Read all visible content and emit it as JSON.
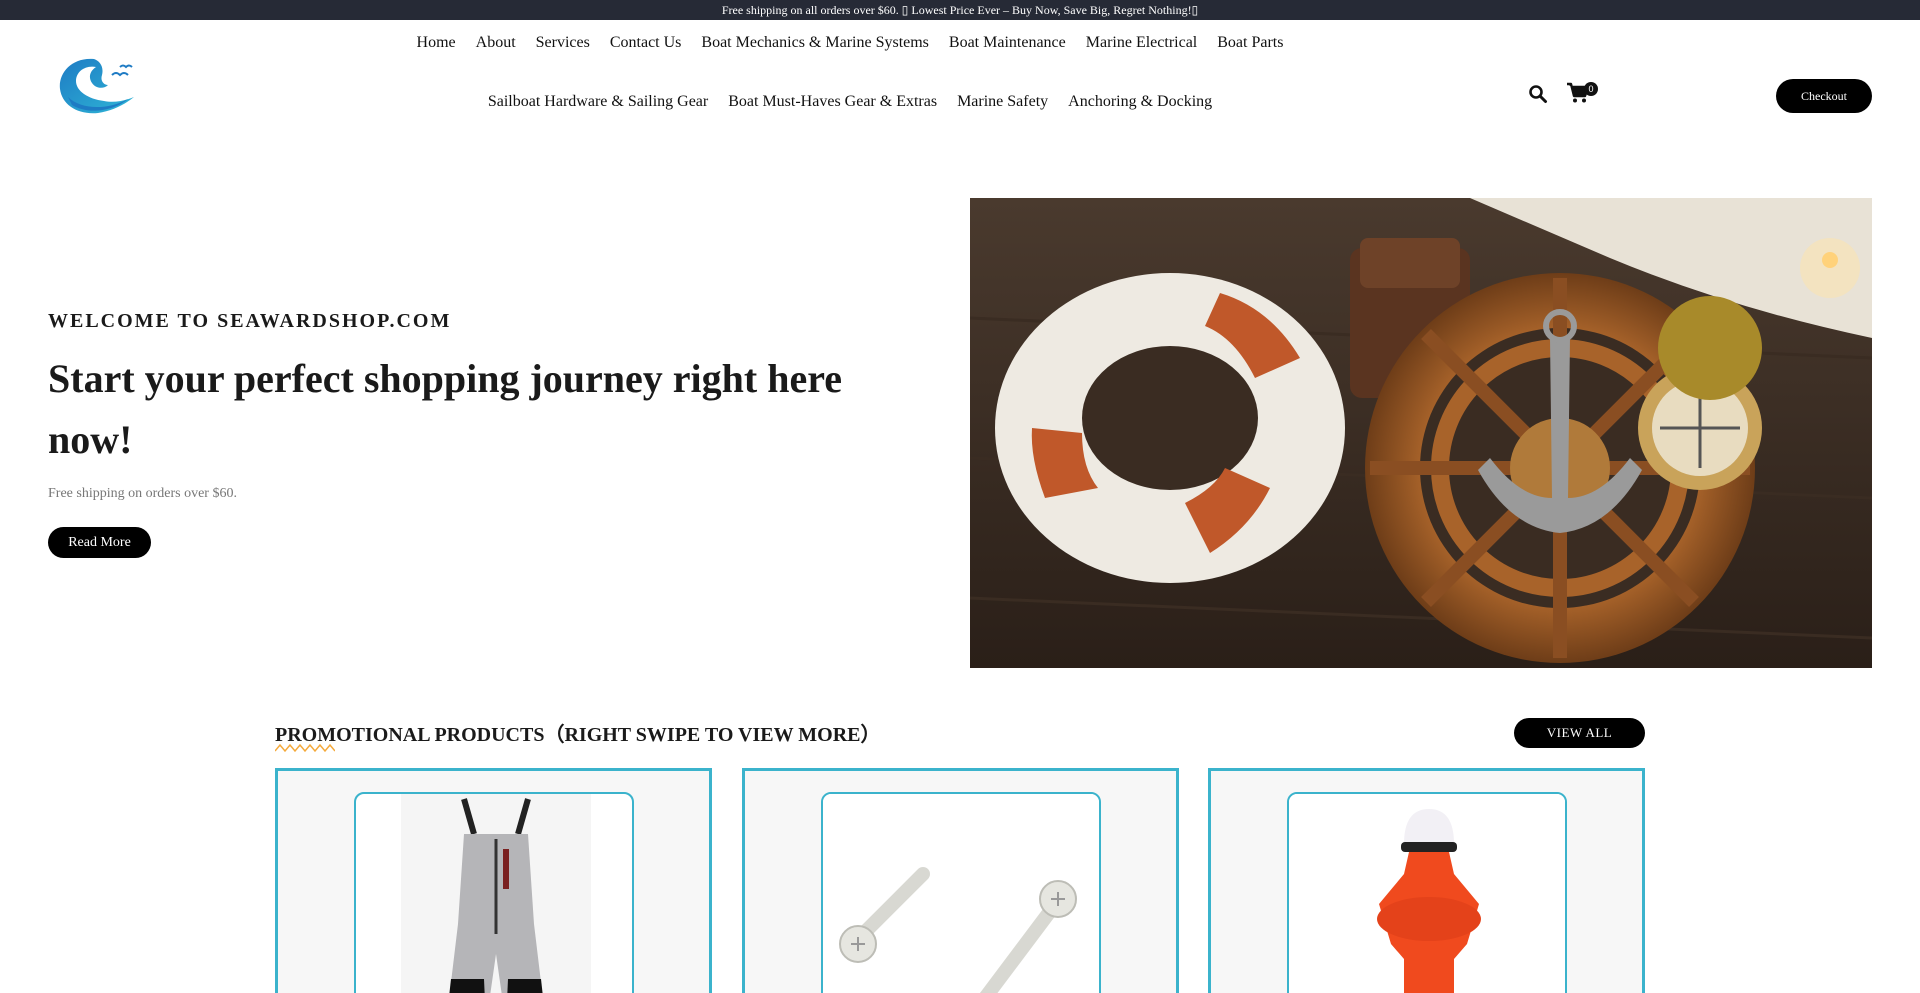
{
  "announcement": "Free shipping on all orders over $60. ▯ Lowest Price Ever – Buy Now, Save Big, Regret Nothing!▯",
  "nav": {
    "row1": [
      "Home",
      "About",
      "Services",
      "Contact Us",
      "Boat Mechanics & Marine Systems",
      "Boat Maintenance",
      "Marine Electrical",
      "Boat Parts"
    ],
    "row2": [
      "Sailboat Hardware & Sailing Gear",
      "Boat Must-Haves Gear & Extras",
      "Marine Safety",
      "Anchoring & Docking"
    ]
  },
  "cart": {
    "count": "0"
  },
  "checkout_label": "Checkout",
  "hero": {
    "kicker": "WELCOME TO SEAWARDSHOP.COM",
    "title": "Start your perfect shopping journey right here now!",
    "subtitle": "Free shipping on orders over $60.",
    "button": "Read More"
  },
  "promo": {
    "title": "PROMOTIONAL PRODUCTS（RIGHT SWIPE TO VIEW MORE）",
    "view_all": "VIEW ALL",
    "products": [
      "bib-overalls-image",
      "screws-image",
      "orange-safety-light-image"
    ]
  },
  "colors": {
    "topbar": "#262a36",
    "accent": "#3bb3cc",
    "wavy": "#f4a93b"
  }
}
